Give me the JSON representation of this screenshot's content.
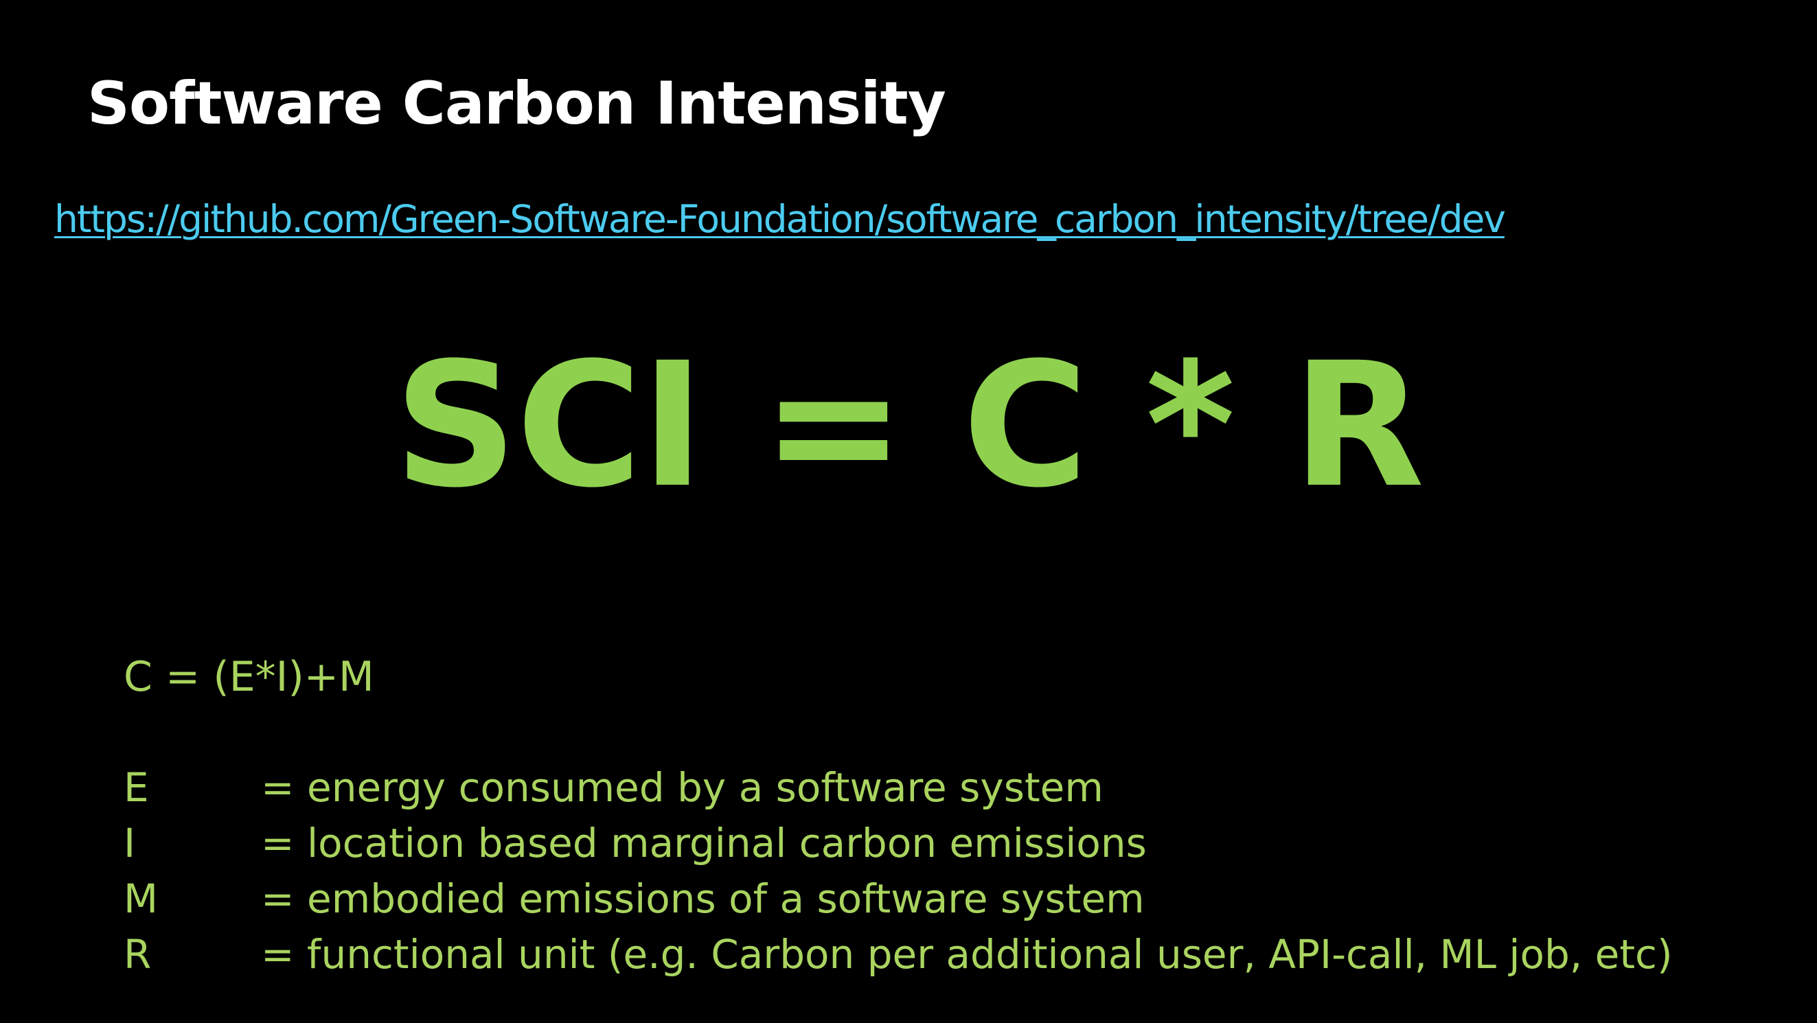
{
  "slide": {
    "title": "Software Carbon Intensity",
    "link": "https://github.com/Green-Software-Foundation/software_carbon_intensity/tree/dev",
    "formula": "SCI = C * R",
    "sub_formula": "C = (E*I)+M",
    "definitions": [
      {
        "var": "E",
        "desc": "= energy consumed by a software system"
      },
      {
        "var": "I",
        "desc": "= location based marginal carbon emissions"
      },
      {
        "var": "M",
        "desc": "= embodied emissions of a software system"
      },
      {
        "var": "R",
        "desc": "= functional unit (e.g. Carbon per additional user, API-call, ML job, etc)"
      }
    ]
  },
  "colors": {
    "background": "#000000",
    "title": "#ffffff",
    "link": "#4ccbef",
    "formula": "#8fd14f",
    "body_text": "#a9d45f"
  }
}
